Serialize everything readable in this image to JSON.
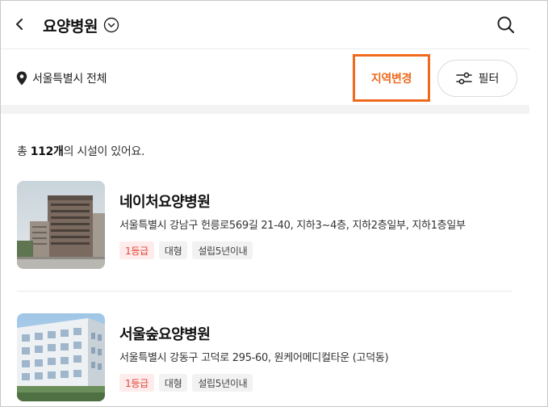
{
  "header": {
    "title": "요양병원",
    "back_icon": "chevron-left-icon",
    "title_chevron_icon": "chevron-down-circle-icon",
    "search_icon": "search-icon"
  },
  "location": {
    "pin_icon": "map-pin-icon",
    "label": "서울특별시 전체",
    "change_region_label": "지역변경",
    "filter_label": "필터",
    "filter_icon": "sliders-icon",
    "accent_color": "#f06a1e"
  },
  "results": {
    "prefix": "총 ",
    "count": "112개",
    "suffix": "의 시설이 있어요."
  },
  "facilities": [
    {
      "name": "네이처요양병원",
      "address": "서울특별시 강남구 헌릉로569길 21-40, 지하3~4층, 지하2층일부, 지하1층일부",
      "tags": [
        "1등급",
        "대형",
        "설립5년이내"
      ]
    },
    {
      "name": "서울숲요양병원",
      "address": "서울특별시 강동구 고덕로 295-60, 원케어메디컬타운 (고덕동)",
      "tags": [
        "1등급",
        "대형",
        "설립5년이내"
      ]
    }
  ]
}
